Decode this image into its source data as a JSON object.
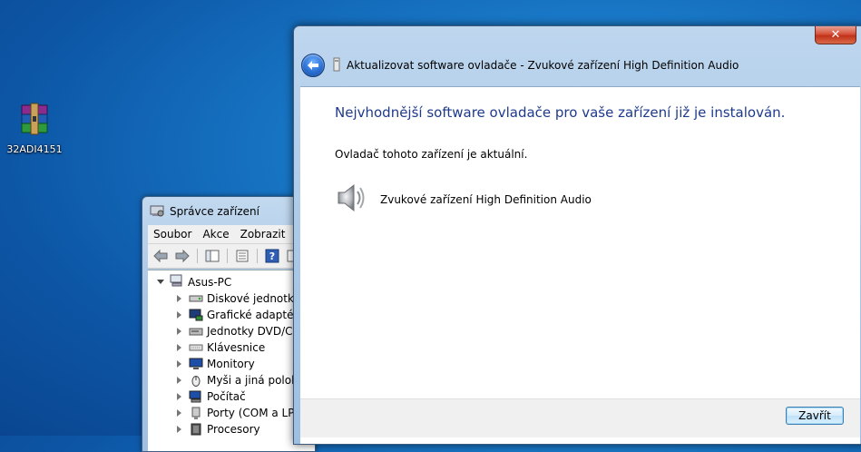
{
  "desktop": {
    "icon_label": "32ADI4151"
  },
  "device_manager": {
    "title": "Správce zařízení",
    "menu": [
      "Soubor",
      "Akce",
      "Zobrazit"
    ],
    "root": "Asus-PC",
    "items": [
      {
        "label": "Diskové jednotky",
        "icon": "disk-drive-icon"
      },
      {
        "label": "Grafické adaptéry",
        "icon": "display-adapter-icon"
      },
      {
        "label": "Jednotky DVD/CD",
        "icon": "dvd-drive-icon"
      },
      {
        "label": "Klávesnice",
        "icon": "keyboard-icon"
      },
      {
        "label": "Monitory",
        "icon": "monitor-icon"
      },
      {
        "label": "Myši a jiná polohovací",
        "icon": "mouse-icon"
      },
      {
        "label": "Počítač",
        "icon": "computer-icon"
      },
      {
        "label": "Porty (COM a LPT)",
        "icon": "port-icon"
      },
      {
        "label": "Procesory",
        "icon": "processor-icon"
      }
    ]
  },
  "dialog": {
    "nav_title": "Aktualizovat software ovladače - Zvukové zařízení High Definition Audio",
    "heading": "Nejvhodnější software ovladače pro vaše zařízení již je instalován.",
    "status": "Ovladač tohoto zařízení je aktuální.",
    "device_name": "Zvukové zařízení High Definition Audio",
    "close_label": "Zavřít",
    "close_glyph": "✕"
  }
}
